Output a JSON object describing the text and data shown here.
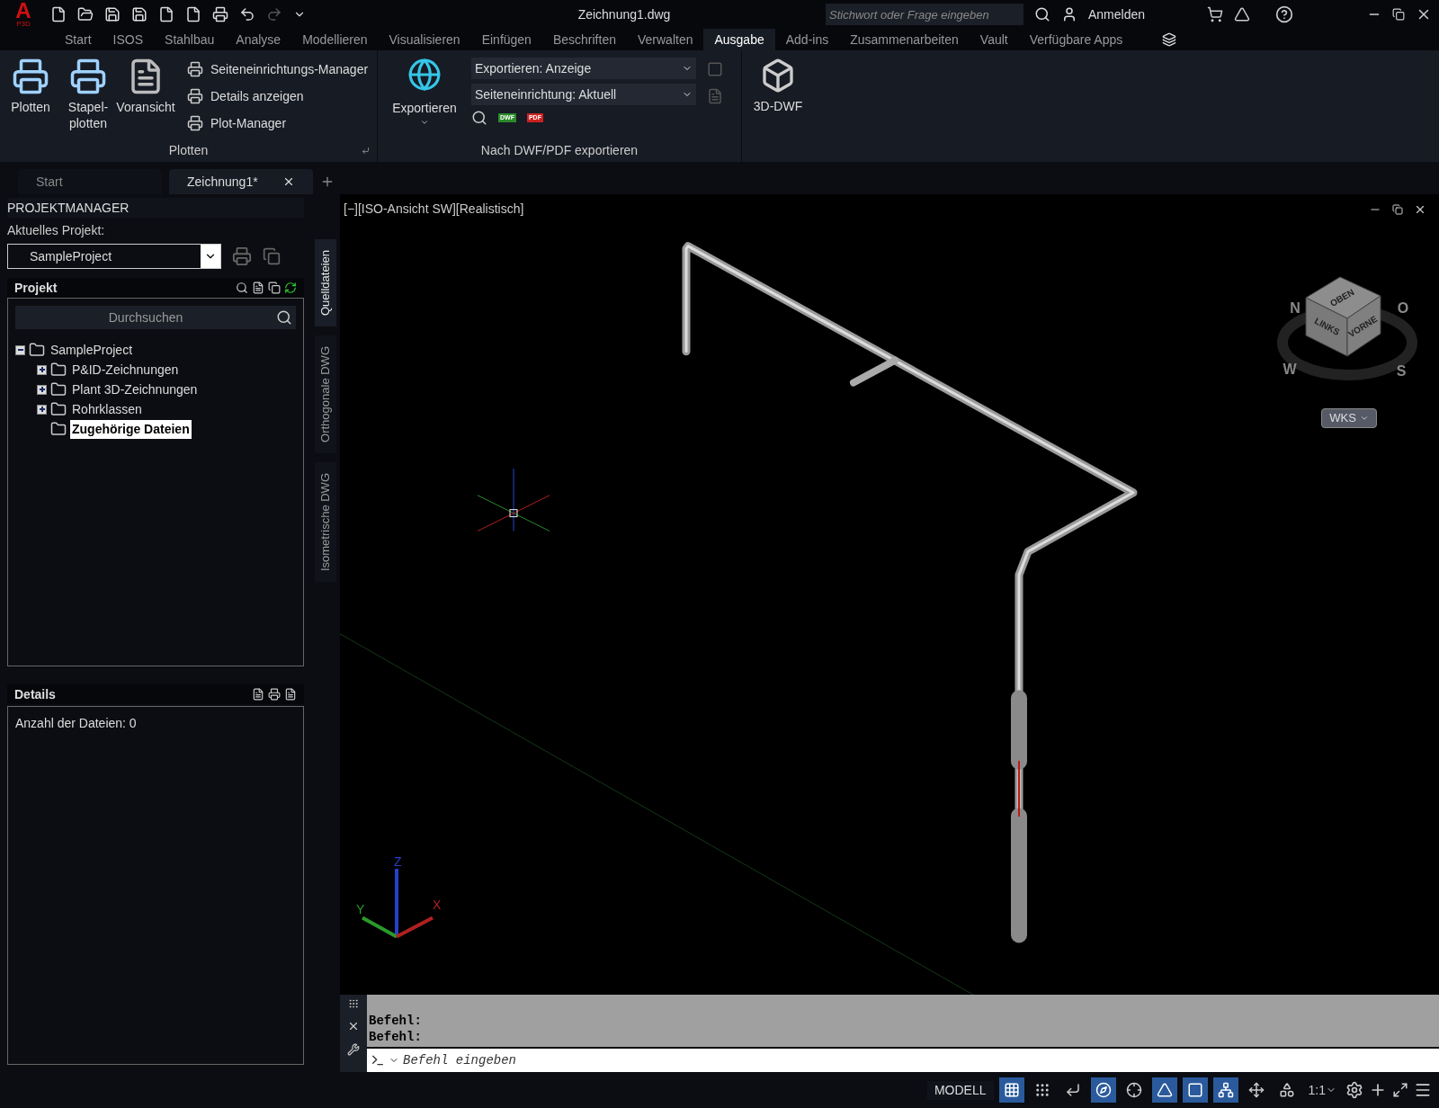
{
  "title_bar": {
    "app_letter": "A",
    "app_badge": "P3D",
    "title": "Zeichnung1.dwg",
    "search": {
      "placeholder": "Stichwort oder Frage eingeben"
    },
    "sign_in": "Anmelden"
  },
  "ribbon_tabs": [
    {
      "label": "Start",
      "selected": false
    },
    {
      "label": "ISOS",
      "selected": false
    },
    {
      "label": "Stahlbau",
      "selected": false
    },
    {
      "label": "Analyse",
      "selected": false
    },
    {
      "label": "Modellieren",
      "selected": false
    },
    {
      "label": "Visualisieren",
      "selected": false
    },
    {
      "label": "Einfügen",
      "selected": false
    },
    {
      "label": "Beschriften",
      "selected": false
    },
    {
      "label": "Verwalten",
      "selected": false
    },
    {
      "label": "Ausgabe",
      "selected": true
    },
    {
      "label": "Add-ins",
      "selected": false
    },
    {
      "label": "Zusammenarbeiten",
      "selected": false
    },
    {
      "label": "Vault",
      "selected": false
    },
    {
      "label": "Verfügbare Apps",
      "selected": false
    }
  ],
  "ribbon": {
    "plot_panel": {
      "title": "Plotten",
      "large_buttons": [
        {
          "kind": "plot",
          "label": "Plotten"
        },
        {
          "kind": "batch",
          "label": "Stapel-\nplotten"
        },
        {
          "kind": "preview",
          "label": "Voransicht"
        }
      ],
      "small_buttons": [
        "Seiteneinrichtungs-Manager",
        "Details anzeigen",
        "Plot-Manager"
      ]
    },
    "export_panel": {
      "title": "Nach DWF/PDF exportieren",
      "large_button": "Exportieren",
      "dropdowns": [
        "Exportieren: Anzeige",
        "Seiteneinrichtung: Aktuell"
      ],
      "file_badges": [
        "DWF",
        "PDF"
      ]
    },
    "dwf3d_button": "3D-DWF"
  },
  "document_tabs": [
    {
      "label": "Start",
      "selected": false
    },
    {
      "label": "Zeichnung1*",
      "selected": true
    }
  ],
  "project_manager": {
    "title": "PROJEKTMANAGER",
    "current_label": "Aktuelles Projekt:",
    "current_project": "SampleProject",
    "section": "Projekt",
    "search": {
      "placeholder": "Durchsuchen"
    },
    "tree": [
      {
        "label": "SampleProject",
        "expanded": true,
        "selected": false,
        "children": [
          {
            "label": "P&ID-Zeichnungen",
            "expanded": false,
            "selected": false
          },
          {
            "label": "Plant 3D-Zeichnungen",
            "expanded": false,
            "selected": false
          },
          {
            "label": "Rohrklassen",
            "expanded": false,
            "selected": false
          },
          {
            "label": "Zugehörige Dateien",
            "selected": true
          }
        ]
      }
    ],
    "details_title": "Details",
    "details_text": "Anzahl der Dateien: 0"
  },
  "side_tabs": [
    {
      "label": "Quelldateien",
      "selected": true
    },
    {
      "label": "Orthogonale DWG",
      "selected": false
    },
    {
      "label": "Isometrische DWG",
      "selected": false
    }
  ],
  "viewport": {
    "label": "[−][ISO-Ansicht SW][Realistisch]",
    "viewcube": {
      "top": "OBEN",
      "left": "LINKS",
      "front": "VORNE",
      "compass": [
        "N",
        "O",
        "W",
        "S"
      ],
      "coordinate_system": "WKS"
    },
    "axes": [
      "X",
      "Y",
      "Z"
    ]
  },
  "command_line": {
    "history": [
      "Befehl:",
      "Befehl:"
    ],
    "placeholder": "Befehl eingeben"
  },
  "status_bar": {
    "space": "MODELL",
    "scale": "1:1",
    "toggles": [
      {
        "kind": "grid",
        "on": true
      },
      {
        "kind": "snap",
        "on": false
      },
      {
        "kind": "ortho",
        "on": false
      },
      {
        "kind": "polar",
        "on": true
      },
      {
        "kind": "track",
        "on": false
      },
      {
        "kind": "isodraft",
        "on": true
      },
      {
        "kind": "dynucs",
        "on": true
      },
      {
        "kind": "annovis",
        "on": true
      },
      {
        "kind": "autoscale",
        "on": false
      },
      {
        "kind": "annoscale",
        "on": false
      }
    ]
  }
}
